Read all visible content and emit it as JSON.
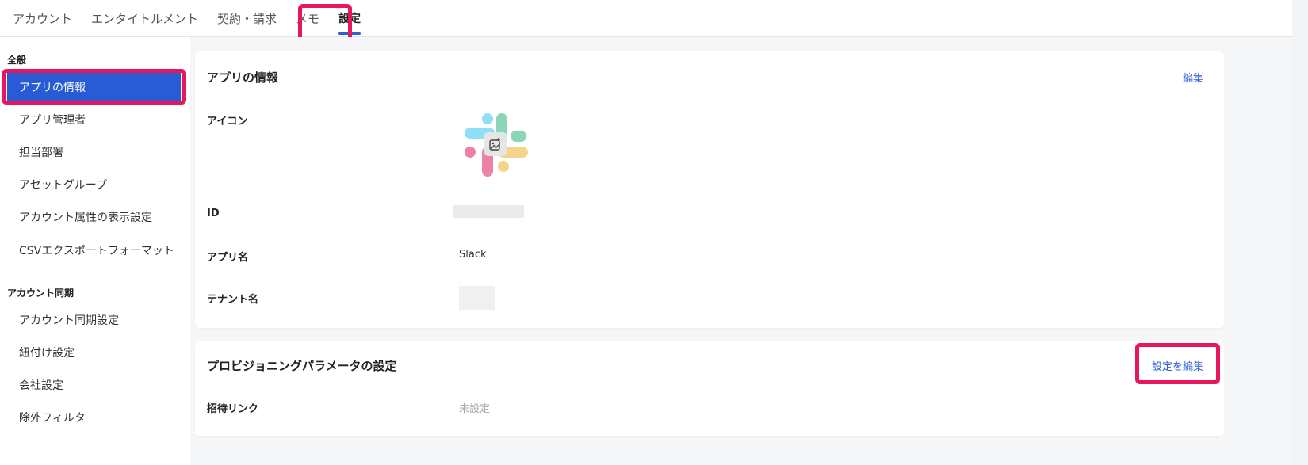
{
  "tabs": [
    {
      "label": "アカウント",
      "active": false
    },
    {
      "label": "エンタイトルメント",
      "active": false
    },
    {
      "label": "契約・請求",
      "active": false
    },
    {
      "label": "メモ",
      "active": false
    },
    {
      "label": "設定",
      "active": true
    }
  ],
  "sidebar": {
    "sections": [
      {
        "title": "全般",
        "items": [
          {
            "label": "アプリの情報",
            "active": true
          },
          {
            "label": "アプリ管理者",
            "active": false
          },
          {
            "label": "担当部署",
            "active": false
          },
          {
            "label": "アセットグループ",
            "active": false
          },
          {
            "label": "アカウント属性の表示設定",
            "active": false
          },
          {
            "label": "CSVエクスポートフォーマット",
            "active": false
          }
        ]
      },
      {
        "title": "アカウント同期",
        "items": [
          {
            "label": "アカウント同期設定",
            "active": false
          },
          {
            "label": "紐付け設定",
            "active": false
          },
          {
            "label": "会社設定",
            "active": false
          },
          {
            "label": "除外フィルタ",
            "active": false
          }
        ]
      }
    ]
  },
  "app_info": {
    "title": "アプリの情報",
    "edit_label": "編集",
    "icon_label": "アイコン",
    "app_icon": "slack-logo-icon",
    "id_label": "ID",
    "name_label": "アプリ名",
    "name_value": "Slack",
    "tenant_label": "テナント名"
  },
  "provisioning": {
    "title": "プロビジョニングパラメータの設定",
    "edit_label": "設定を編集",
    "invite_label": "招待リンク",
    "invite_value": "未設定"
  },
  "colors": {
    "accent": "#2a5bd7",
    "highlight": "#e8175d"
  }
}
